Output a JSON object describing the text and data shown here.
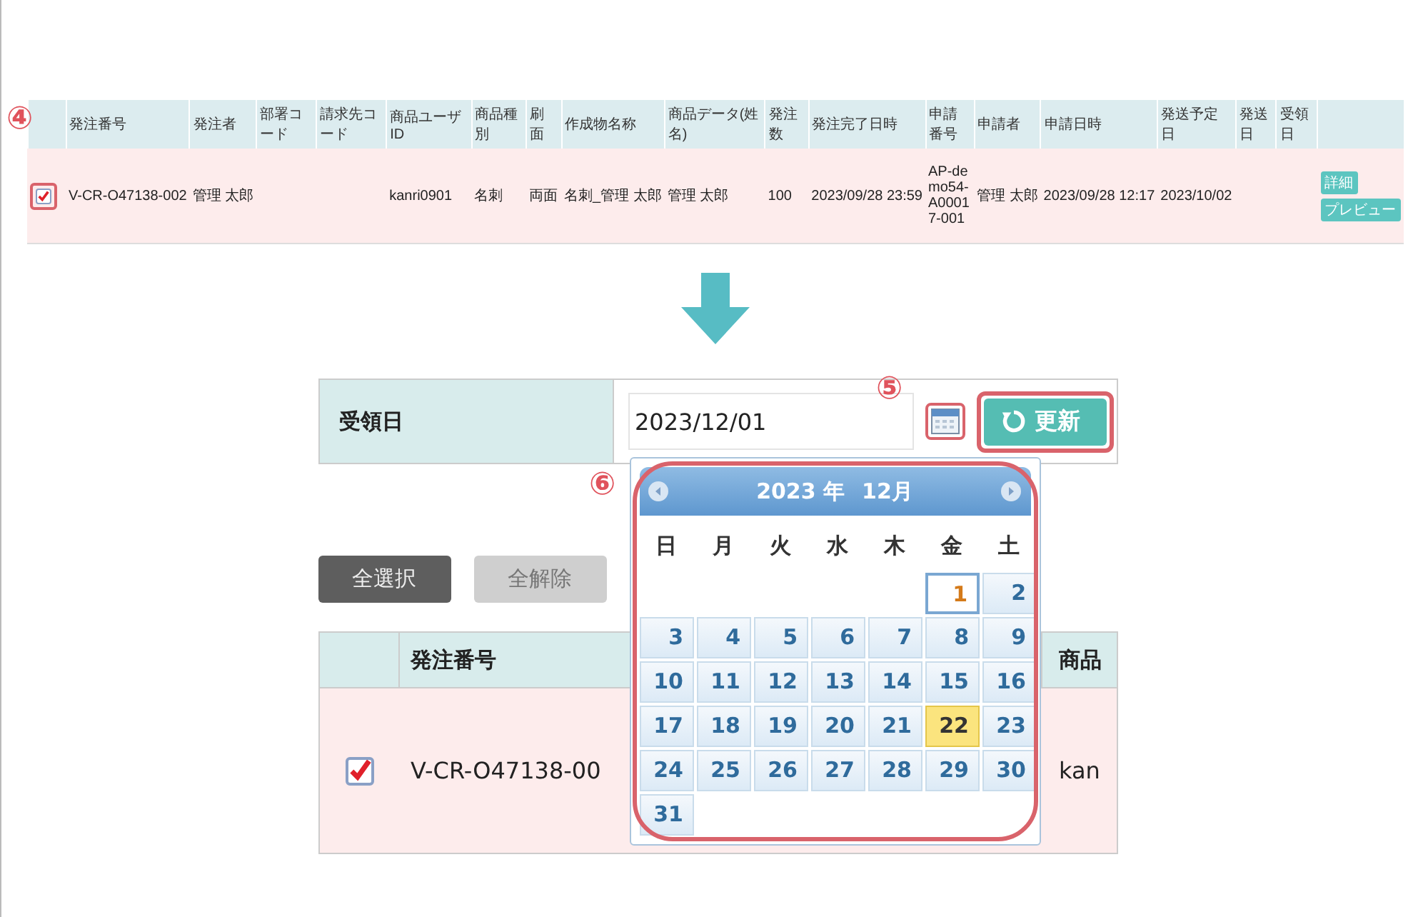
{
  "order_list_table": {
    "step_label": "④",
    "columns": [
      "発注番号",
      "発注者",
      "部署コード",
      "請求先コード",
      "商品ユーザID",
      "商品種別",
      "刷面",
      "作成物名称",
      "商品データ(姓名)",
      "発注数",
      "発注完了日時",
      "申請番号",
      "申請者",
      "申請日時",
      "発送予定日",
      "発送日",
      "受領日"
    ],
    "rows": [
      {
        "selected": true,
        "order_no": "V-CR-O47138-002",
        "orderer": "管理 太郎",
        "product_user_id": "kanri0901",
        "product_type": "名刺",
        "print_side": "両面",
        "item_name": "名刺_管理 太郎",
        "product_data_name": "管理 太郎",
        "quantity": "100",
        "order_completed_at": "2023/09/28 23:59",
        "application_no": "AP-demo54-A00017-001",
        "applicant": "管理 太郎",
        "applied_at": "2023/09/28 12:17",
        "scheduled_ship_date": "2023/10/02",
        "actions": [
          "詳細",
          "プレビュー"
        ]
      }
    ]
  },
  "receipt_date_form": {
    "label": "受領日",
    "value": "2023/12/01",
    "step_label": "⑤",
    "update_button": "更新"
  },
  "calendar": {
    "step_label": "⑥",
    "year": "2023 年",
    "month": "12月",
    "weekdays": [
      "日",
      "月",
      "火",
      "水",
      "木",
      "金",
      "土"
    ],
    "weeks": [
      {
        "kind": "leading",
        "days": [
          {
            "label": "1",
            "selected": true,
            "today": false
          },
          {
            "label": "2",
            "selected": false,
            "today": false
          }
        ]
      },
      {
        "kind": "full",
        "days": [
          {
            "label": "3",
            "selected": false,
            "today": false
          },
          {
            "label": "4",
            "selected": false,
            "today": false
          },
          {
            "label": "5",
            "selected": false,
            "today": false
          },
          {
            "label": "6",
            "selected": false,
            "today": false
          },
          {
            "label": "7",
            "selected": false,
            "today": false
          },
          {
            "label": "8",
            "selected": false,
            "today": false
          },
          {
            "label": "9",
            "selected": false,
            "today": false
          }
        ]
      },
      {
        "kind": "full",
        "days": [
          {
            "label": "10",
            "selected": false,
            "today": false
          },
          {
            "label": "11",
            "selected": false,
            "today": false
          },
          {
            "label": "12",
            "selected": false,
            "today": false
          },
          {
            "label": "13",
            "selected": false,
            "today": false
          },
          {
            "label": "14",
            "selected": false,
            "today": false
          },
          {
            "label": "15",
            "selected": false,
            "today": false
          },
          {
            "label": "16",
            "selected": false,
            "today": false
          }
        ]
      },
      {
        "kind": "full",
        "days": [
          {
            "label": "17",
            "selected": false,
            "today": false
          },
          {
            "label": "18",
            "selected": false,
            "today": false
          },
          {
            "label": "19",
            "selected": false,
            "today": false
          },
          {
            "label": "20",
            "selected": false,
            "today": false
          },
          {
            "label": "21",
            "selected": false,
            "today": false
          },
          {
            "label": "22",
            "selected": false,
            "today": true
          },
          {
            "label": "23",
            "selected": false,
            "today": false
          }
        ]
      },
      {
        "kind": "full",
        "days": [
          {
            "label": "24",
            "selected": false,
            "today": false
          },
          {
            "label": "25",
            "selected": false,
            "today": false
          },
          {
            "label": "26",
            "selected": false,
            "today": false
          },
          {
            "label": "27",
            "selected": false,
            "today": false
          },
          {
            "label": "28",
            "selected": false,
            "today": false
          },
          {
            "label": "29",
            "selected": false,
            "today": false
          },
          {
            "label": "30",
            "selected": false,
            "today": false
          }
        ]
      },
      {
        "kind": "trailing",
        "days": [
          {
            "label": "31",
            "selected": false,
            "today": false
          }
        ]
      }
    ]
  },
  "selection_buttons": [
    {
      "label": "全選択",
      "disabled": false
    },
    {
      "label": "全解除",
      "disabled": true
    }
  ],
  "order_table": {
    "columns": [
      "発注番号",
      "商品"
    ],
    "rows": [
      {
        "selected": true,
        "cells": [
          "V-CR-O47138-00",
          "kan"
        ]
      }
    ]
  }
}
